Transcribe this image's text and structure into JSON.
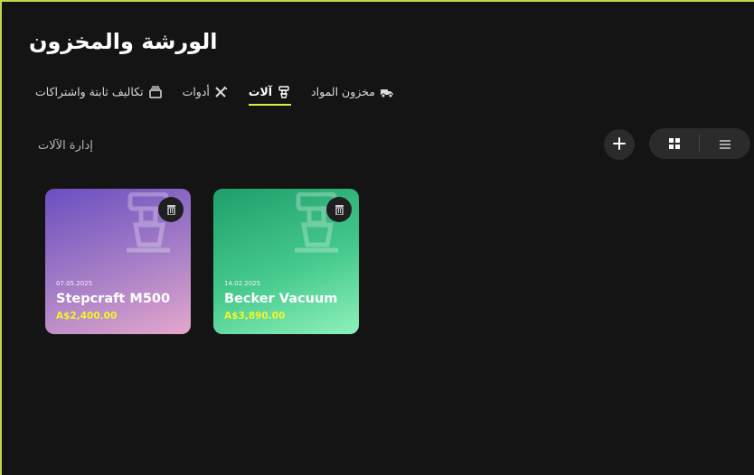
{
  "page": {
    "title": "الورشة والمخزون"
  },
  "tabs": [
    {
      "label": "مخزون المواد",
      "icon": "truck-icon",
      "active": false
    },
    {
      "label": "آلات",
      "icon": "machine-icon",
      "active": true
    },
    {
      "label": "أدوات",
      "icon": "tools-icon",
      "active": false
    },
    {
      "label": "تكاليف ثابتة واشتراكات",
      "icon": "subscriptions-icon",
      "active": false
    }
  ],
  "section": {
    "title": "إدارة الآلات"
  },
  "toolbar": {
    "add_icon": "plus-icon",
    "view_modes": [
      {
        "icon": "grid-view-icon",
        "active": true
      },
      {
        "icon": "list-view-icon",
        "active": false
      }
    ]
  },
  "machines": [
    {
      "date": "07.05.2025",
      "name": "Stepcraft M500",
      "price": "A$2,400.00",
      "gradient": [
        "#6a4fc0",
        "#e3a7cc"
      ]
    },
    {
      "date": "14.02.2025",
      "name": "Becker Vacuum",
      "price": "A$3,890.00",
      "gradient": [
        "#1f9e6b",
        "#8ef1bb"
      ]
    }
  ],
  "colors": {
    "accent": "#d6f13d",
    "background": "#141414",
    "price": "#f2f52a",
    "frame": "#c6d64c"
  }
}
